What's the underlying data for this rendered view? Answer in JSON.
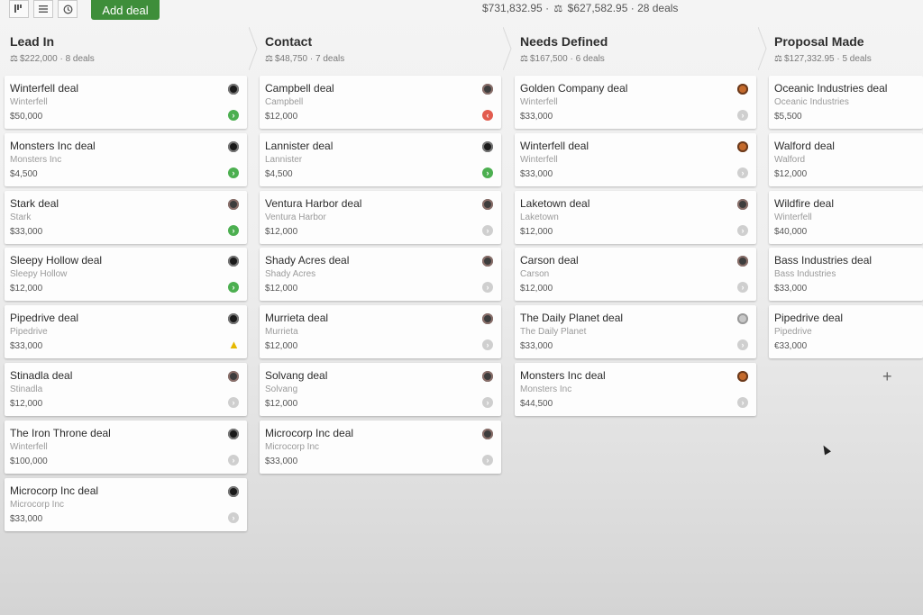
{
  "toolbar": {
    "view_icons": [
      "pipeline-view-icon",
      "list-view-icon",
      "forecast-view-icon"
    ],
    "add_deal_label": "Add deal"
  },
  "summary": {
    "total_value": "$731,832.95",
    "weighted_value": "$627,582.95",
    "deal_count": "28 deals"
  },
  "stages": [
    {
      "name": "Lead In",
      "summary": "$222,000 · 8 deals",
      "deals": [
        {
          "title": "Winterfell deal",
          "org": "Winterfell",
          "value": "$50,000",
          "status": "green"
        },
        {
          "title": "Monsters Inc deal",
          "org": "Monsters Inc",
          "value": "$4,500",
          "status": "green"
        },
        {
          "title": "Stark deal",
          "org": "Stark",
          "value": "$33,000",
          "status": "green"
        },
        {
          "title": "Sleepy Hollow deal",
          "org": "Sleepy Hollow",
          "value": "$12,000",
          "status": "green"
        },
        {
          "title": "Pipedrive deal",
          "org": "Pipedrive",
          "value": "$33,000",
          "status": "warn"
        },
        {
          "title": "Stinadla deal",
          "org": "Stinadla",
          "value": "$12,000",
          "status": "grey"
        },
        {
          "title": "The Iron Throne deal",
          "org": "Winterfell",
          "value": "$100,000",
          "status": "grey"
        },
        {
          "title": "Microcorp Inc deal",
          "org": "Microcorp Inc",
          "value": "$33,000",
          "status": "grey"
        }
      ]
    },
    {
      "name": "Contact",
      "summary": "$48,750 · 7 deals",
      "deals": [
        {
          "title": "Campbell deal",
          "org": "Campbell",
          "value": "$12,000",
          "status": "red"
        },
        {
          "title": "Lannister deal",
          "org": "Lannister",
          "value": "$4,500",
          "status": "green"
        },
        {
          "title": "Ventura Harbor deal",
          "org": "Ventura Harbor",
          "value": "$12,000",
          "status": "grey"
        },
        {
          "title": "Shady Acres deal",
          "org": "Shady Acres",
          "value": "$12,000",
          "status": "grey"
        },
        {
          "title": "Murrieta deal",
          "org": "Murrieta",
          "value": "$12,000",
          "status": "grey"
        },
        {
          "title": "Solvang deal",
          "org": "Solvang",
          "value": "$12,000",
          "status": "grey"
        },
        {
          "title": "Microcorp Inc deal",
          "org": "Microcorp Inc",
          "value": "$33,000",
          "status": "grey"
        }
      ]
    },
    {
      "name": "Needs Defined",
      "summary": "$167,500 · 6 deals",
      "deals": [
        {
          "title": "Golden Company deal",
          "org": "Winterfell",
          "value": "$33,000",
          "status": "grey"
        },
        {
          "title": "Winterfell deal",
          "org": "Winterfell",
          "value": "$33,000",
          "status": "grey"
        },
        {
          "title": "Laketown deal",
          "org": "Laketown",
          "value": "$12,000",
          "status": "grey"
        },
        {
          "title": "Carson deal",
          "org": "Carson",
          "value": "$12,000",
          "status": "grey"
        },
        {
          "title": "The Daily Planet deal",
          "org": "The Daily Planet",
          "value": "$33,000",
          "status": "grey"
        },
        {
          "title": "Monsters Inc deal",
          "org": "Monsters Inc",
          "value": "$44,500",
          "status": "grey"
        }
      ]
    },
    {
      "name": "Proposal Made",
      "summary": "$127,332.95 · 5 deals",
      "deals": [
        {
          "title": "Oceanic Industries deal",
          "org": "Oceanic Industries",
          "value": "$5,500",
          "status": "none"
        },
        {
          "title": "Walford deal",
          "org": "Walford",
          "value": "$12,000",
          "status": "none"
        },
        {
          "title": "Wildfire deal",
          "org": "Winterfell",
          "value": "$40,000",
          "status": "none"
        },
        {
          "title": "Bass Industries deal",
          "org": "Bass Industries",
          "value": "$33,000",
          "status": "none"
        },
        {
          "title": "Pipedrive deal",
          "org": "Pipedrive",
          "value": "€33,000",
          "status": "none"
        }
      ]
    }
  ],
  "colors": {
    "accent_green": "#3e8e3a",
    "status_green": "#4caf50",
    "status_red": "#e25c4f",
    "status_grey": "#cfcfcf",
    "warning_yellow": "#e6b800"
  }
}
